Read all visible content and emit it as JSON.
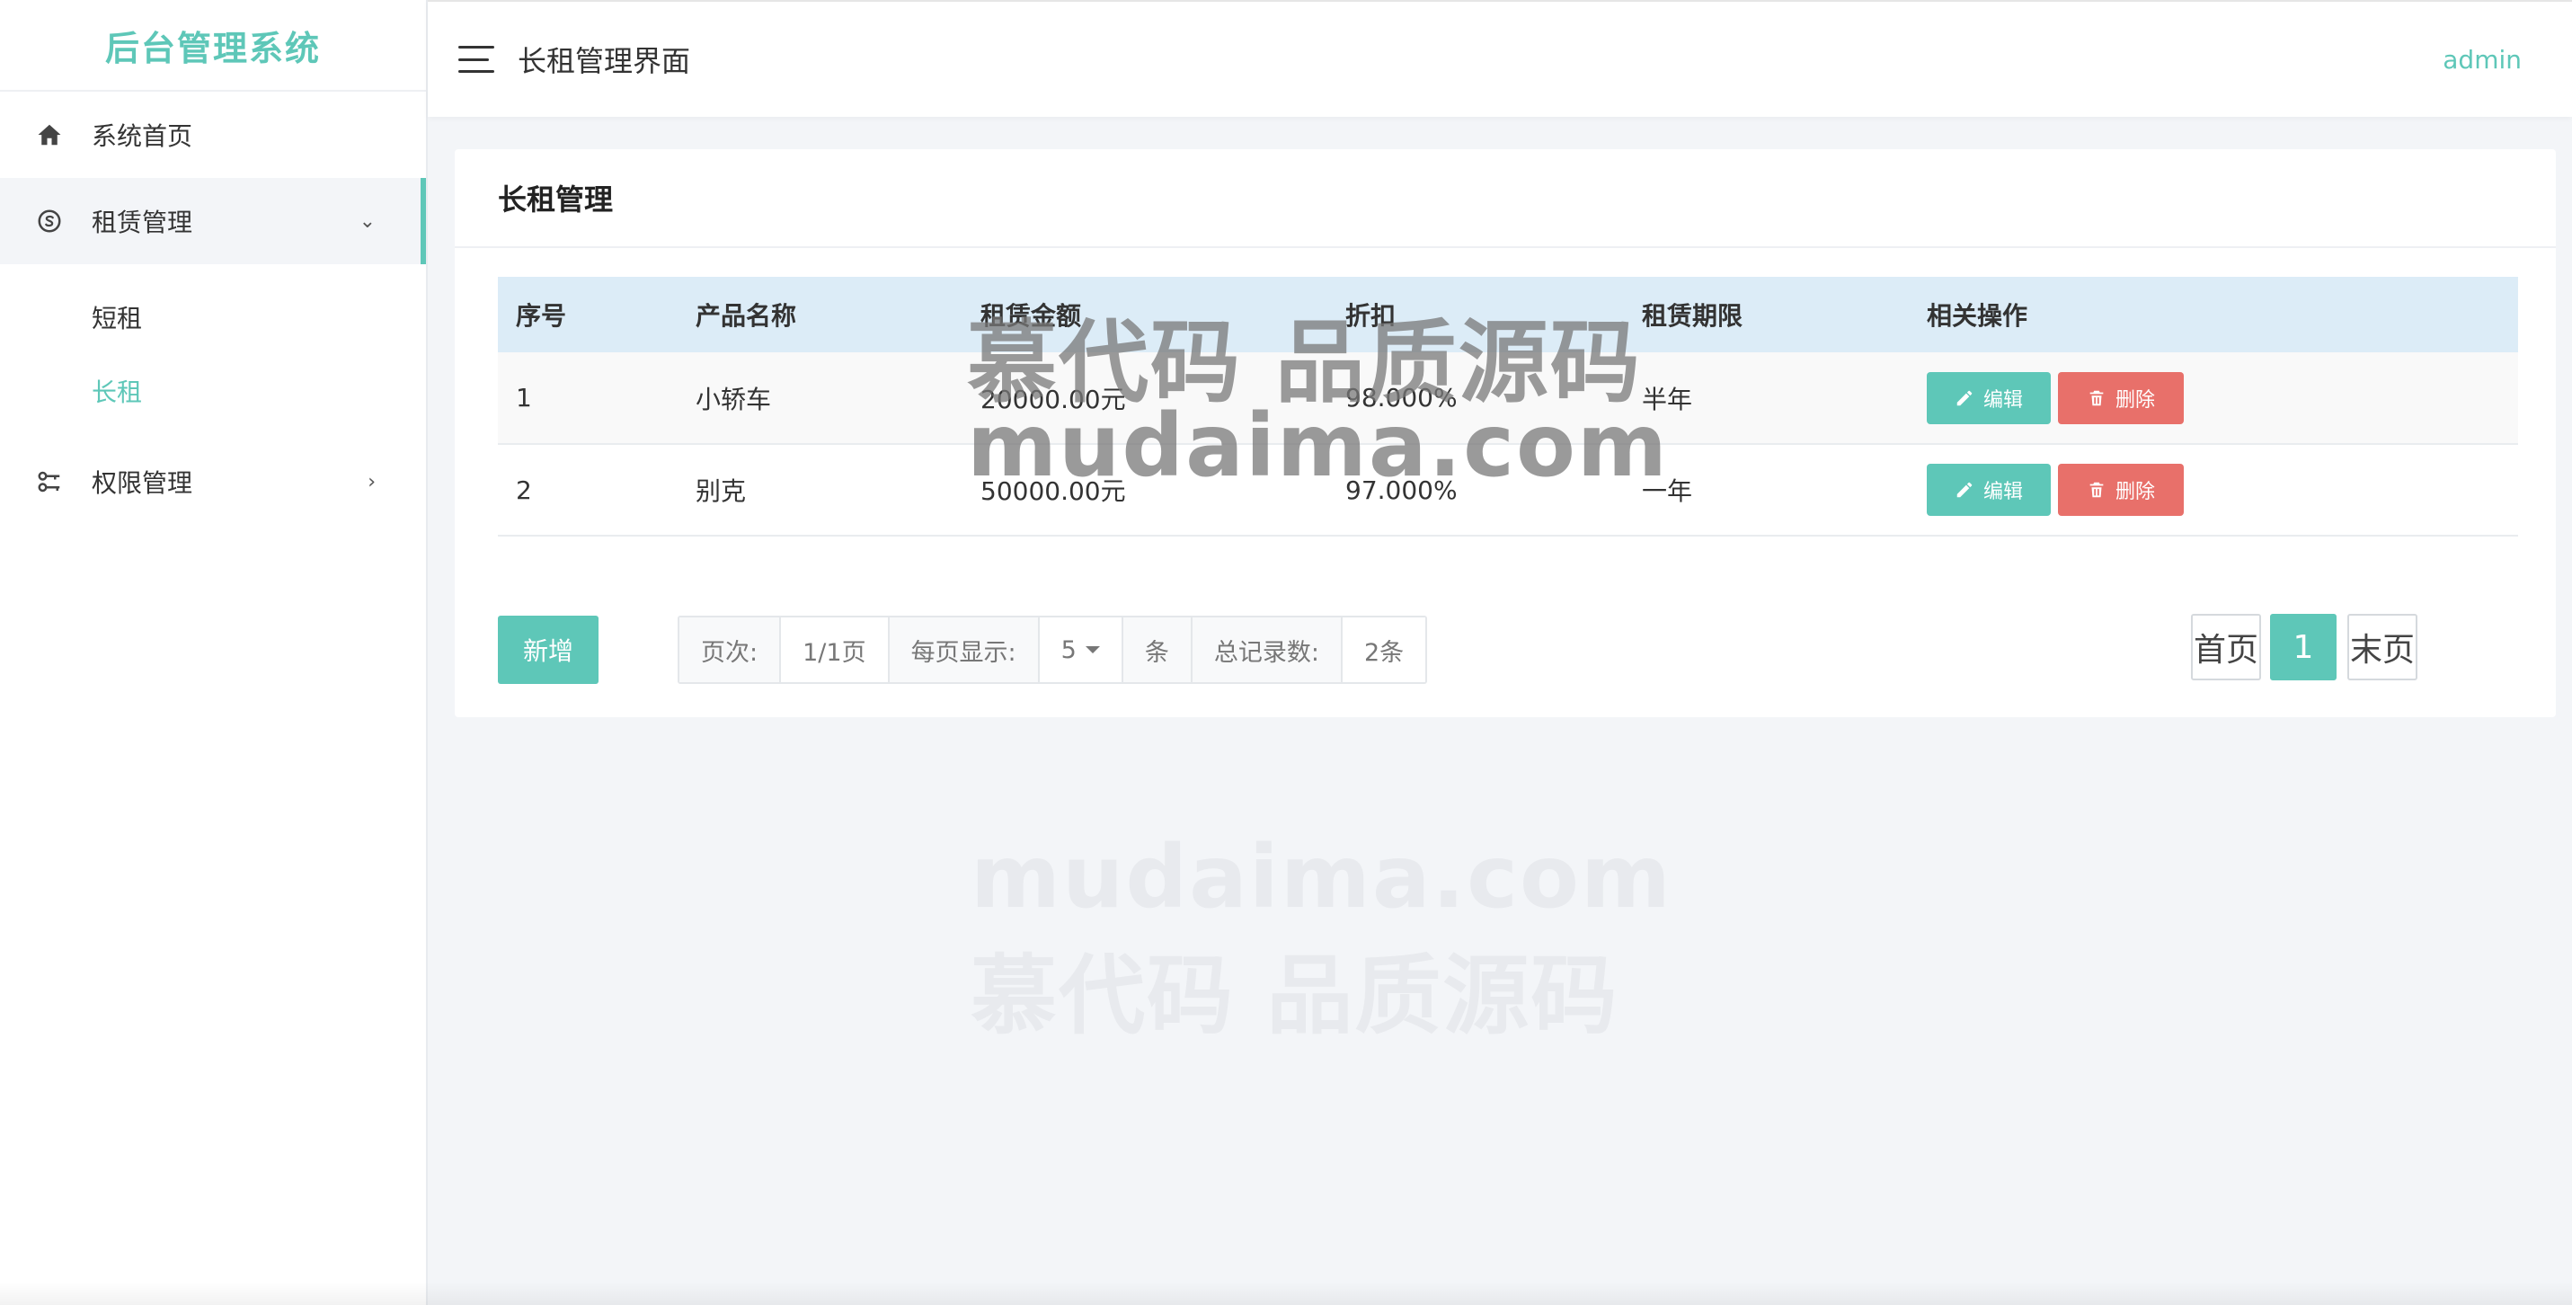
{
  "sidebar": {
    "brand": "后台管理系统",
    "items": [
      {
        "label": "系统首页",
        "icon": "home-icon"
      },
      {
        "label": "租赁管理",
        "icon": "skype-icon",
        "expanded": true,
        "children": [
          {
            "label": "短租",
            "active": false
          },
          {
            "label": "长租",
            "active": true
          }
        ]
      },
      {
        "label": "权限管理",
        "icon": "key-icon",
        "expanded": false
      }
    ]
  },
  "header": {
    "title": "长租管理界面",
    "user": "admin"
  },
  "card": {
    "title": "长租管理",
    "table": {
      "columns": [
        "序号",
        "产品名称",
        "租赁金额",
        "折扣",
        "租赁期限",
        "相关操作"
      ],
      "rows": [
        {
          "no": "1",
          "name": "小轿车",
          "amount": "20000.00元",
          "discount": "98.000%",
          "term": "半年"
        },
        {
          "no": "2",
          "name": "别克",
          "amount": "50000.00元",
          "discount": "97.000%",
          "term": "一年"
        }
      ],
      "edit_label": "编辑",
      "delete_label": "删除"
    },
    "add_label": "新增",
    "pager": {
      "page_label": "页次:",
      "page_value": "1/1页",
      "per_page_label": "每页显示:",
      "per_page_value": "5",
      "per_page_unit": "条",
      "total_label": "总记录数:",
      "total_value": "2条",
      "first_label": "首页",
      "current": "1",
      "last_label": "末页"
    }
  },
  "watermark": {
    "line1": "慕代码 品质源码",
    "line2": "mudaima.com"
  },
  "colors": {
    "accent": "#5ec7b8",
    "danger": "#e8706a",
    "table_header": "#dcecf7"
  }
}
